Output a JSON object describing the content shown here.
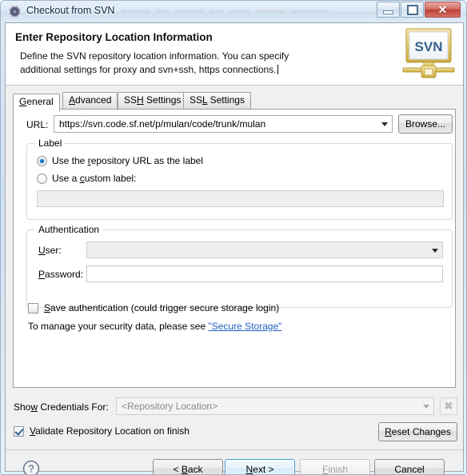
{
  "window": {
    "title": "Checkout from SVN",
    "icon": "svn-gear-icon",
    "ghost_text": "Ghost of window behind the glass title bar",
    "controls": {
      "minimize": "Minimize",
      "maximize": "Maximize",
      "close": "Close"
    }
  },
  "header": {
    "title": "Enter Repository Location Information",
    "description_line1": "Define the SVN repository location information. You can specify",
    "description_line2": "additional settings for proxy and svn+ssh, https connections.",
    "banner_text": "SVN",
    "banner_text_color": "#36618c"
  },
  "tabs": [
    {
      "label_before": "",
      "mnemonic": "G",
      "label_after": "eneral",
      "selected": true
    },
    {
      "label_before": "",
      "mnemonic": "A",
      "label_after": "dvanced",
      "selected": false
    },
    {
      "label_before": "SS",
      "mnemonic": "H",
      "label_after": " Settings",
      "selected": false
    },
    {
      "label_before": "SS",
      "mnemonic": "L",
      "label_after": " Settings",
      "selected": false
    }
  ],
  "general_tab": {
    "url": {
      "label": "URL:",
      "value": "https://svn.code.sf.net/p/mulan/code/trunk/mulan",
      "placeholder": ""
    },
    "browse_button": "Browse...",
    "label_group": {
      "legend": "Label",
      "radio_url": {
        "before": "Use the ",
        "mnemonic": "r",
        "after": "epository URL as the label",
        "checked": true
      },
      "radio_custom": {
        "before": "Use a ",
        "mnemonic": "c",
        "after": "ustom label:",
        "checked": false
      },
      "custom_label_value": "",
      "custom_label_placeholder": "",
      "custom_label_disabled": true
    },
    "authentication_group": {
      "legend": "Authentication",
      "user": {
        "before": "",
        "mnemonic": "U",
        "after": "ser:",
        "value": "",
        "placeholder": ""
      },
      "password": {
        "before": "",
        "mnemonic": "P",
        "after": "assword:",
        "value": "",
        "placeholder": ""
      },
      "save_auth": {
        "before": "",
        "mnemonic": "S",
        "after": "ave authentication (could trigger secure storage login)",
        "checked": false
      },
      "security_note_prefix": "To manage your security data, please see ",
      "security_link": "\"Secure Storage\"",
      "link_color": "#1f5fbf"
    }
  },
  "credentials": {
    "label_before": "Sho",
    "label_mnemonic": "w",
    "label_after": " Credentials For:",
    "combo_placeholder": "<Repository Location>",
    "combo_value": "",
    "combo_disabled": true,
    "clear_button_icon": "clear-x-icon",
    "clear_button_disabled": true
  },
  "validate": {
    "before": "",
    "mnemonic": "V",
    "after": "alidate Repository Location on finish",
    "checked": true
  },
  "reset_button": {
    "before": "",
    "mnemonic": "R",
    "after": "eset Changes"
  },
  "footer": {
    "help_icon": "help-question-icon",
    "buttons": [
      {
        "before": "< ",
        "mnemonic": "B",
        "after": "ack",
        "state": "normal"
      },
      {
        "before": "",
        "mnemonic": "N",
        "after": "ext >",
        "state": "default"
      },
      {
        "before": "",
        "mnemonic": "F",
        "after": "inish",
        "state": "disabled"
      },
      {
        "before": "",
        "mnemonic": "",
        "after": "Cancel",
        "state": "normal"
      }
    ]
  },
  "colors": {
    "accent": "#1d78c8",
    "default_button_border": "#3c9ad1",
    "link": "#1f5fbf",
    "close_button": "#bc4038",
    "panel_bg": "#ffffff",
    "dialog_bg": "#f0f0f0"
  }
}
